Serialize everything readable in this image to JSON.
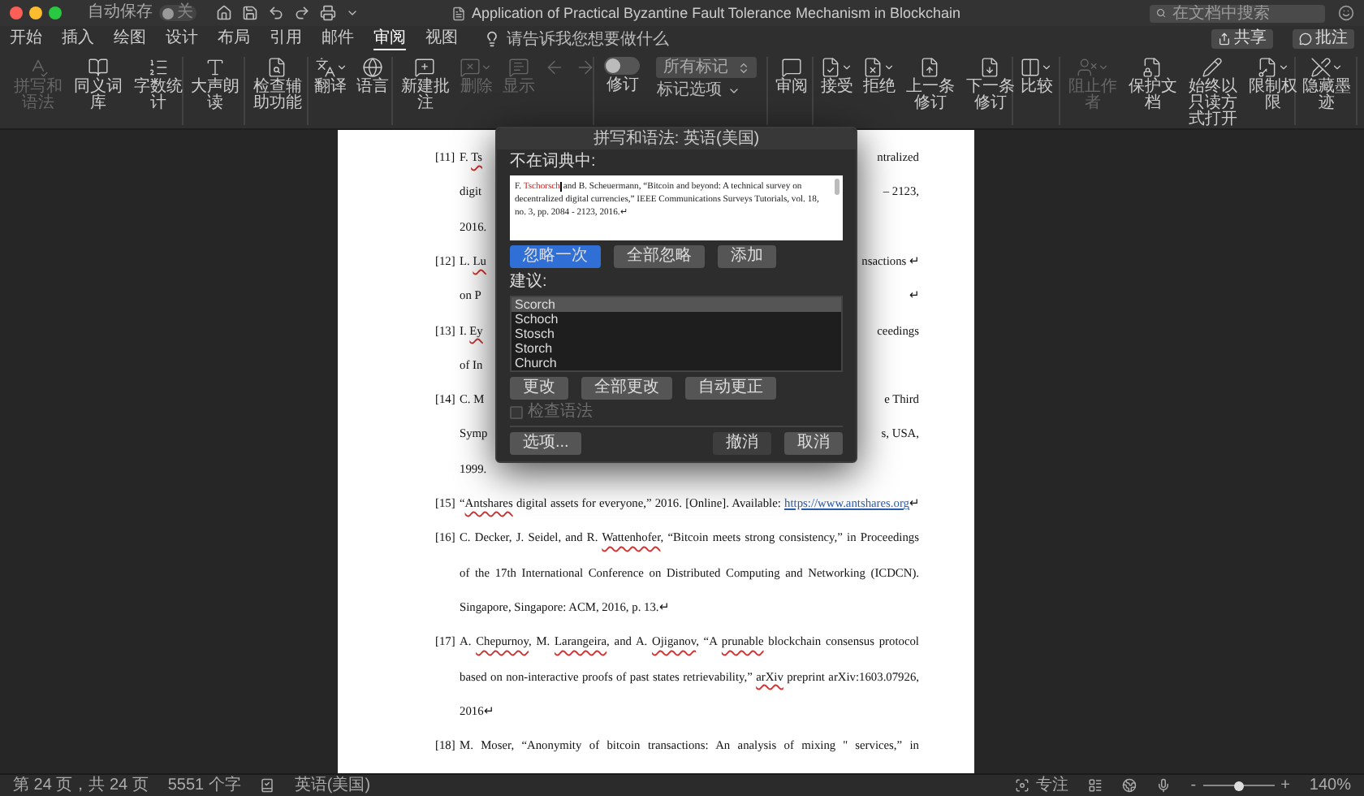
{
  "window": {
    "title": "Application of Practical Byzantine Fault Tolerance Mechanism in Blockchain",
    "autosave_label": "自动保存",
    "autosave_state": "关",
    "autosave_on": false
  },
  "search": {
    "placeholder": "在文档中搜索"
  },
  "menu_tabs": [
    {
      "label": "开始",
      "selected": false
    },
    {
      "label": "插入",
      "selected": false
    },
    {
      "label": "绘图",
      "selected": false
    },
    {
      "label": "设计",
      "selected": false
    },
    {
      "label": "布局",
      "selected": false
    },
    {
      "label": "引用",
      "selected": false
    },
    {
      "label": "邮件",
      "selected": false
    },
    {
      "label": "审阅",
      "selected": true
    },
    {
      "label": "视图",
      "selected": false
    }
  ],
  "tell_me": {
    "placeholder": "请告诉我您想要做什么"
  },
  "share_buttons": [
    "共享",
    "批注"
  ],
  "ribbon": [
    {
      "items": [
        {
          "kind": "spelling",
          "label": "拼写和语法",
          "disabled": true,
          "caret": false
        },
        {
          "kind": "thesaurus",
          "label": "同义词库",
          "disabled": false,
          "caret": false
        },
        {
          "kind": "word-count",
          "label": "字数统计",
          "disabled": false,
          "caret": false
        }
      ]
    },
    {
      "items": [
        {
          "kind": "read-aloud",
          "label": "大声朗读",
          "disabled": false,
          "caret": false
        }
      ]
    },
    {
      "items": [
        {
          "kind": "accessibility",
          "label": "检查辅助功能",
          "disabled": false,
          "caret": false
        }
      ]
    },
    {
      "items": [
        {
          "kind": "translate",
          "label": "翻译",
          "disabled": false,
          "caret": true
        },
        {
          "kind": "language",
          "label": "语言",
          "disabled": false,
          "caret": false
        }
      ]
    },
    {
      "items": [
        {
          "kind": "new-comment",
          "label": "新建批注",
          "disabled": false,
          "caret": false
        },
        {
          "kind": "delete-comment",
          "label": "删除",
          "disabled": true,
          "caret": true
        },
        {
          "kind": "show-comments",
          "label": "显示",
          "disabled": true,
          "caret": false
        },
        {
          "kind": "previous-comment",
          "disabled": true,
          "caret": false
        },
        {
          "kind": "next-comment",
          "disabled": true,
          "caret": false
        }
      ]
    },
    {
      "items": [
        {
          "kind": "track-changes",
          "label": "修订",
          "on": false
        },
        {
          "kind": "markup",
          "value": "所有标记",
          "options_label": "标记选项"
        }
      ]
    },
    {
      "items": [
        {
          "kind": "reviewing-pane",
          "label": "审阅",
          "disabled": false,
          "caret": false
        }
      ]
    },
    {
      "items": [
        {
          "kind": "accept",
          "label": "接受",
          "disabled": false,
          "caret": true
        },
        {
          "kind": "reject",
          "label": "拒绝",
          "disabled": false,
          "caret": true
        },
        {
          "kind": "previous-change",
          "label": "上一条修订",
          "disabled": false,
          "caret": false
        },
        {
          "kind": "next-change",
          "label": "下一条修订",
          "disabled": false,
          "caret": false
        }
      ]
    },
    {
      "items": [
        {
          "kind": "compare",
          "label": "比较",
          "disabled": false,
          "caret": true
        }
      ]
    },
    {
      "items": [
        {
          "kind": "block-authors",
          "label": "阻止作者",
          "disabled": true,
          "caret": true
        },
        {
          "kind": "protect",
          "label": "保护文档",
          "disabled": false,
          "caret": false
        },
        {
          "kind": "read-only",
          "label": "始终以只读方式打开",
          "disabled": false,
          "caret": false
        },
        {
          "kind": "restrict",
          "label": "限制权限",
          "disabled": false,
          "caret": true
        }
      ]
    },
    {
      "items": [
        {
          "kind": "hide-ink",
          "label": "隐藏墨迹",
          "disabled": false,
          "caret": true
        }
      ]
    }
  ],
  "document": {
    "lines": [
      {
        "number": "[11]",
        "kind": "cut",
        "left": [
          {
            "text": "F. ",
            "kind": "text"
          },
          {
            "text": "Ts",
            "kind": "misspelled"
          }
        ],
        "right": [
          {
            "text": "ntralized",
            "kind": "text"
          }
        ]
      },
      {
        "kind": "cut",
        "left": [
          {
            "text": "digit",
            "kind": "text"
          }
        ],
        "right": [
          {
            "text": "– 2123,",
            "kind": "text"
          }
        ]
      },
      {
        "kind": "end",
        "left": [
          {
            "text": "2016.",
            "kind": "text"
          }
        ]
      },
      {
        "number": "[12]",
        "kind": "cut",
        "left": [
          {
            "text": "L. ",
            "kind": "text"
          },
          {
            "text": "Lu",
            "kind": "misspelled"
          }
        ],
        "right": [
          {
            "text": "nsactions ↵",
            "kind": "text"
          }
        ]
      },
      {
        "kind": "cut",
        "left": [
          {
            "text": "on P",
            "kind": "text"
          }
        ],
        "right": [
          {
            "text": "↵",
            "kind": "text"
          }
        ]
      },
      {
        "number": "[13]",
        "kind": "cut",
        "left": [
          {
            "text": "I. ",
            "kind": "text"
          },
          {
            "text": "Ey",
            "kind": "misspelled"
          }
        ],
        "right": [
          {
            "text": "ceedings",
            "kind": "text"
          }
        ]
      },
      {
        "kind": "end",
        "left": [
          {
            "text": "of In",
            "kind": "text"
          }
        ]
      },
      {
        "number": "[14]",
        "kind": "cut",
        "left": [
          {
            "text": "C. M",
            "kind": "text"
          }
        ],
        "right": [
          {
            "text": "e Third",
            "kind": "text"
          }
        ]
      },
      {
        "kind": "cut",
        "left": [
          {
            "text": "Symp",
            "kind": "text"
          }
        ],
        "right": [
          {
            "text": "s, USA,",
            "kind": "text"
          }
        ]
      },
      {
        "kind": "end",
        "left": [
          {
            "text": "1999.",
            "kind": "text"
          }
        ]
      },
      {
        "number": "[15]",
        "kind": "full",
        "left": [
          {
            "text": "“",
            "kind": "text"
          },
          {
            "text": "Antshares",
            "kind": "misspelled"
          },
          {
            "text": " digital assets for everyone,” 2016. [Online]. Available: ",
            "kind": "text"
          },
          {
            "text": "https://www.antshares.org",
            "kind": "link"
          },
          {
            "text": "↵",
            "kind": "text"
          }
        ]
      },
      {
        "number": "[16]",
        "kind": "full",
        "left": [
          {
            "text": "C. Decker, J. Seidel, and R. ",
            "kind": "text"
          },
          {
            "text": "Wattenhofer",
            "kind": "misspelled"
          },
          {
            "text": ", “Bitcoin meets strong consistency,” in Proceedings",
            "kind": "text"
          }
        ]
      },
      {
        "kind": "full",
        "left": [
          {
            "text": "of the 17th International Conference on Distributed Computing and Networking (ICDCN).",
            "kind": "text"
          }
        ]
      },
      {
        "kind": "end",
        "left": [
          {
            "text": "Singapore, Singapore: ACM, 2016, p. 13.↵",
            "kind": "text"
          }
        ]
      },
      {
        "number": "[17]",
        "kind": "full",
        "left": [
          {
            "text": "A. ",
            "kind": "text"
          },
          {
            "text": "Chepurnoy",
            "kind": "misspelled"
          },
          {
            "text": ", M. ",
            "kind": "text"
          },
          {
            "text": "Larangeira",
            "kind": "misspelled"
          },
          {
            "text": ", and A. ",
            "kind": "text"
          },
          {
            "text": "Ojiganov",
            "kind": "misspelled"
          },
          {
            "text": ", “A ",
            "kind": "text"
          },
          {
            "text": "prunable",
            "kind": "misspelled"
          },
          {
            "text": " blockchain consensus protocol",
            "kind": "text"
          }
        ]
      },
      {
        "kind": "full",
        "left": [
          {
            "text": "based on non-interactive proofs of past states retrievability,” ",
            "kind": "text"
          },
          {
            "text": "arXiv",
            "kind": "misspelled"
          },
          {
            "text": " preprint arXiv:1603.07926,",
            "kind": "text"
          }
        ]
      },
      {
        "kind": "end",
        "left": [
          {
            "text": "2016↵",
            "kind": "text"
          }
        ]
      },
      {
        "number": "[18]",
        "kind": "full",
        "left": [
          {
            "text": "M. Moser, “Anonymity of bitcoin transactions: An analysis of mixing '' services,” in",
            "kind": "text"
          }
        ]
      }
    ]
  },
  "dialog": {
    "title": "拼写和语法: 英语(美国)",
    "not_in_dictionary_label": "不在词典中:",
    "context": {
      "before": "F. ",
      "error": "Tschorsch",
      "after": " and B. Scheuermann, “Bitcoin and beyond: A technical survey on decentralized digital currencies,” IEEE Communications Surveys Tutorials, vol. 18, no. 3, pp. 2084 - 2123, 2016.↵"
    },
    "buttons_row1": [
      {
        "label": "忽略一次",
        "selected": true
      },
      {
        "label": "全部忽略",
        "selected": false
      },
      {
        "label": "添加",
        "selected": false
      }
    ],
    "suggestions_label": "建议:",
    "suggestions": [
      {
        "text": "Scorch",
        "selected": true
      },
      {
        "text": "Schoch",
        "selected": false
      },
      {
        "text": "Stosch",
        "selected": false
      },
      {
        "text": "Storch",
        "selected": false
      },
      {
        "text": "Church",
        "selected": false
      }
    ],
    "buttons_row2": [
      "更改",
      "全部更改",
      "自动更正"
    ],
    "check_grammar": {
      "label": "检查语法",
      "checked": false,
      "disabled": true
    },
    "options_button": "选项...",
    "undo_button": {
      "label": "撤消",
      "disabled": true
    },
    "cancel_button": "取消"
  },
  "status_bar": {
    "page": "第 24 页，共 24 页",
    "words": "5551 个字",
    "language": "英语(美国)",
    "focus": "专注",
    "zoom_out": "-",
    "zoom_in": "+",
    "zoom": {
      "level": 0.5
    },
    "zoom_reading": "140%"
  }
}
